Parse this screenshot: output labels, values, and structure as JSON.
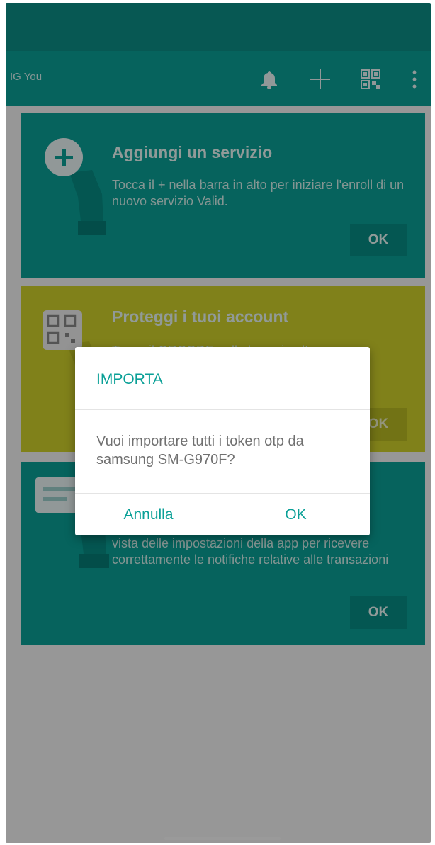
{
  "app": {
    "title": "IG You",
    "icons": [
      "bell-icon",
      "add-icon",
      "qr-code-icon",
      "overflow-menu-icon"
    ]
  },
  "cards": [
    {
      "title": "Aggiungi un servizio",
      "description": "Tocca il + nella barra in alto per iniziare l'enroll di un nuovo servizio Valid.",
      "ok_label": "OK",
      "icon": "add-circle-hand-icon",
      "color": "#0aa097"
    },
    {
      "title": "Proteggi i tuoi account",
      "description": "Tocca il QRCODE nella barra in alto",
      "ok_label": "OK",
      "icon": "qr-hand-icon",
      "color": "#cfd12b"
    },
    {
      "title": "",
      "description": "vista delle impostazioni della app per ricevere correttamente le notifiche relative alle transazioni",
      "ok_label": "OK",
      "icon": "list-hand-icon",
      "color": "#0aa097"
    }
  ],
  "dialog": {
    "title": "IMPORTA",
    "message": "Vuoi importare tutti i token otp da samsung SM-G970F?",
    "cancel_label": "Annulla",
    "ok_label": "OK"
  },
  "colors": {
    "accent": "#0aa097",
    "statusbar": "#0c8f86",
    "olive": "#cfd12b"
  }
}
